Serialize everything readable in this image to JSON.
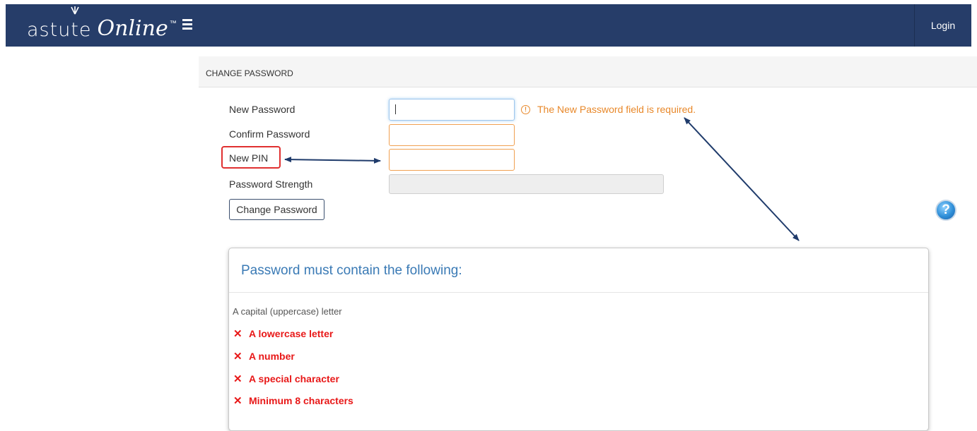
{
  "navbar": {
    "logo_word1": "astute",
    "logo_word2": "Online",
    "logo_tm": "™",
    "menu_icon": "hamburger-icon",
    "login_label": "Login",
    "bg_color": "#263d69"
  },
  "panel": {
    "title": "CHANGE PASSWORD"
  },
  "form": {
    "new_password_label": "New Password",
    "confirm_password_label": "Confirm Password",
    "new_pin_label": "New PIN",
    "strength_label": "Password Strength",
    "new_password_value": "",
    "confirm_password_value": "",
    "new_pin_value": "",
    "error_icon": "!",
    "error_message": "The New Password field is required.",
    "submit_label": "Change Password",
    "help_label": "?"
  },
  "requirements": {
    "title": "Password must contain the following:",
    "met": [
      "A capital (uppercase) letter"
    ],
    "unmet_mark": "✕",
    "unmet": [
      "A lowercase letter",
      "A number",
      "A special character",
      "Minimum 8 characters"
    ]
  },
  "colors": {
    "error": "#e8882a",
    "fail": "#e81818",
    "title": "#3a7ab5",
    "arrow": "#1f3b6b"
  }
}
